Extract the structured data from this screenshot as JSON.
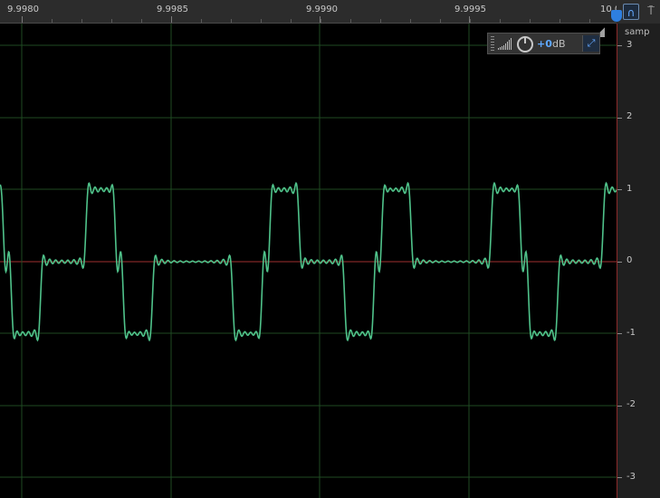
{
  "ruler": {
    "labels": [
      "9.9980",
      "9.9985",
      "9.9990",
      "9.9995",
      "10.0"
    ]
  },
  "amplitude_axis": {
    "unit": "samp",
    "labels": [
      "3",
      "2",
      "1",
      "0",
      "-1",
      "-2",
      "-3"
    ]
  },
  "volume_hud": {
    "gain_value": "+0",
    "gain_unit": "dB",
    "meter_icon": "level-meter-icon",
    "knob_icon": "volume-knob-icon",
    "pin_icon": "pin-icon"
  },
  "toolbar": {
    "snap_icon": "magnet-icon",
    "pin_icon": "pin-icon"
  },
  "colors": {
    "waveform": "#4fc28a",
    "grid": "#1f4a22",
    "zero_line": "#a03030",
    "ruler_bg": "#2c2c2c",
    "accent": "#2e7fe0"
  },
  "waveform": {
    "description_type": "band-limited square pulse train",
    "pulses": [
      {
        "sign": 1
      },
      {
        "sign": -1
      },
      {
        "sign": 1
      },
      {
        "sign": -1
      }
    ]
  }
}
